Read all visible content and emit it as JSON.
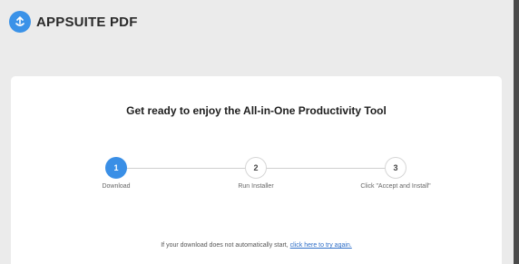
{
  "header": {
    "brand": "APPSUITE PDF",
    "logo_icon": "appsuite-logo-icon",
    "logo_color": "#3a92e8"
  },
  "main": {
    "headline": "Get ready to enjoy the All-in-One Productivity Tool",
    "steps": [
      {
        "number": "1",
        "label": "Download",
        "state": "active"
      },
      {
        "number": "2",
        "label": "Run Installer",
        "state": "idle"
      },
      {
        "number": "3",
        "label": "Click \"Accept and Install\"",
        "state": "idle"
      }
    ],
    "footer_text": "If your download does not automatically start,",
    "footer_link": "click here to try again.",
    "accent_color": "#3a8fe6",
    "link_color": "#2f6fc8"
  }
}
